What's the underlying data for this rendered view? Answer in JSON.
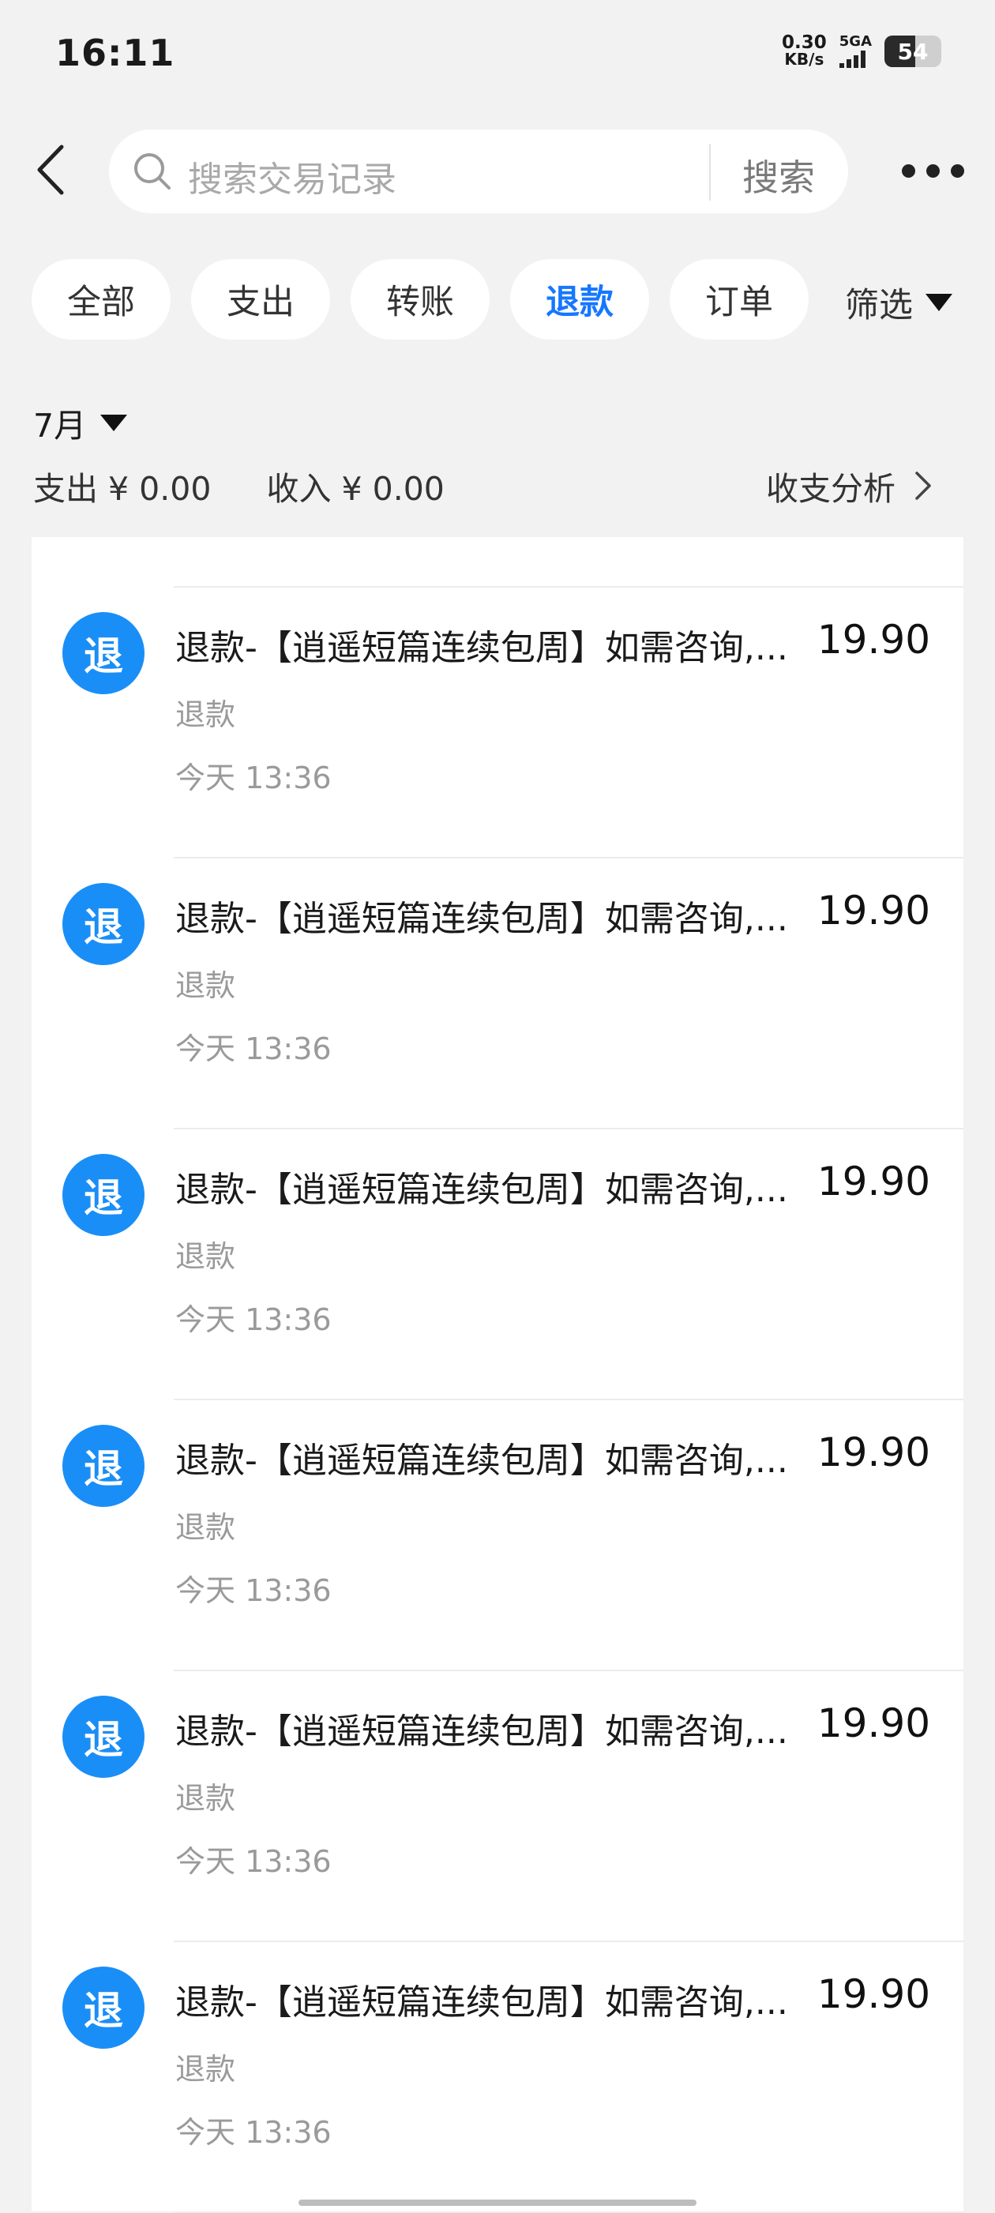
{
  "status_bar": {
    "time": "16:11",
    "net_speed_value": "0.30",
    "net_speed_unit": "KB/s",
    "network": "5GA",
    "battery": "54",
    "battery_level": 0.54
  },
  "search": {
    "placeholder": "搜索交易记录",
    "button_label": "搜索"
  },
  "tabs": [
    {
      "label": "全部",
      "active": false
    },
    {
      "label": "支出",
      "active": false
    },
    {
      "label": "转账",
      "active": false
    },
    {
      "label": "退款",
      "active": true
    },
    {
      "label": "订单",
      "active": false
    }
  ],
  "filter_label": "筛选",
  "month": "7月",
  "summary": {
    "expense": "支出 ¥ 0.00",
    "income": "收入 ¥ 0.00",
    "analysis_label": "收支分析"
  },
  "icon_text": "退",
  "accent_color": "#1677ff",
  "icon_color": "#1a8ef7",
  "transactions": [
    {
      "title": "退款-【逍遥短篇连续包周】如需咨询,...",
      "type": "退款",
      "time": "今天 13:36",
      "amount": "19.90"
    },
    {
      "title": "退款-【逍遥短篇连续包周】如需咨询,...",
      "type": "退款",
      "time": "今天 13:36",
      "amount": "19.90"
    },
    {
      "title": "退款-【逍遥短篇连续包周】如需咨询,...",
      "type": "退款",
      "time": "今天 13:36",
      "amount": "19.90"
    },
    {
      "title": "退款-【逍遥短篇连续包周】如需咨询,...",
      "type": "退款",
      "time": "今天 13:36",
      "amount": "19.90"
    },
    {
      "title": "退款-【逍遥短篇连续包周】如需咨询,...",
      "type": "退款",
      "time": "今天 13:36",
      "amount": "19.90"
    },
    {
      "title": "退款-【逍遥短篇连续包周】如需咨询,...",
      "type": "退款",
      "time": "今天 13:36",
      "amount": "19.90"
    }
  ]
}
